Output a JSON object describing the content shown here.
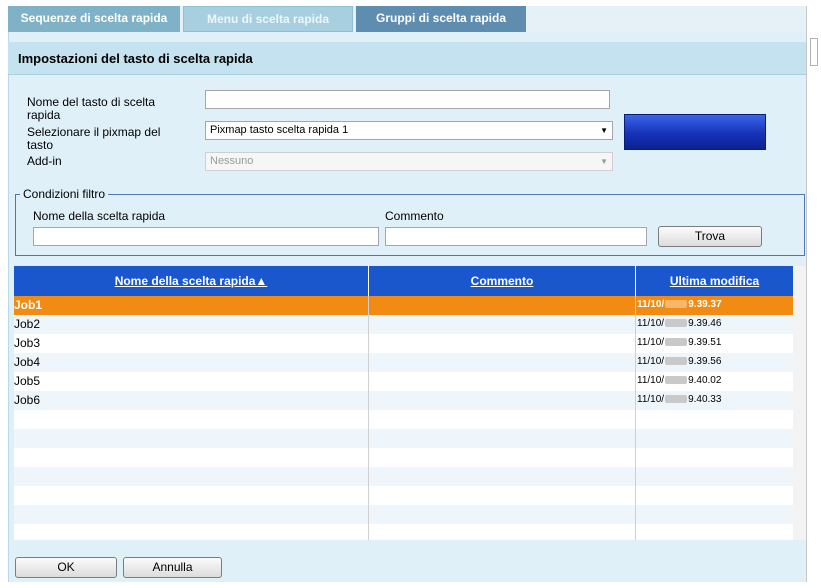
{
  "tabs": [
    {
      "label": "Sequenze di scelta rapida"
    },
    {
      "label": "Menu di scelta rapida"
    },
    {
      "label": "Gruppi di scelta rapida"
    }
  ],
  "section": {
    "title": "Impostazioni del tasto di scelta rapida"
  },
  "form": {
    "name_label_1": "Nome del tasto di scelta",
    "name_label_2": "rapida",
    "name_value": "",
    "pixmap_label_1": "Selezionare il pixmap del",
    "pixmap_label_2": "tasto",
    "pixmap_value": "Pixmap tasto scelta rapida 1",
    "addin_label": "Add-in",
    "addin_value": "Nessuno",
    "preview_color": "#1a3fd0"
  },
  "filter": {
    "legend": "Condizioni filtro",
    "name_label": "Nome della scelta rapida",
    "name_value": "",
    "comment_label": "Commento",
    "comment_value": "",
    "find_button": "Trova"
  },
  "table": {
    "columns": [
      "Nome della scelta rapida▲",
      "Commento",
      "Ultima modifica"
    ],
    "rows": [
      {
        "name": "Job1",
        "comment": "",
        "date_prefix": "11/10/",
        "time": "9.39.37",
        "selected": true
      },
      {
        "name": "Job2",
        "comment": "",
        "date_prefix": "11/10/",
        "time": "9.39.46"
      },
      {
        "name": "Job3",
        "comment": "",
        "date_prefix": "11/10/",
        "time": "9.39.51"
      },
      {
        "name": "Job4",
        "comment": "",
        "date_prefix": "11/10/",
        "time": "9.39.56"
      },
      {
        "name": "Job5",
        "comment": "",
        "date_prefix": "11/10/",
        "time": "9.40.02"
      },
      {
        "name": "Job6",
        "comment": "",
        "date_prefix": "11/10/",
        "time": "9.40.33"
      }
    ],
    "header_color": "#1a56cc",
    "selected_color": "#f28b14"
  },
  "buttons": {
    "ok": "OK",
    "cancel": "Annulla"
  }
}
